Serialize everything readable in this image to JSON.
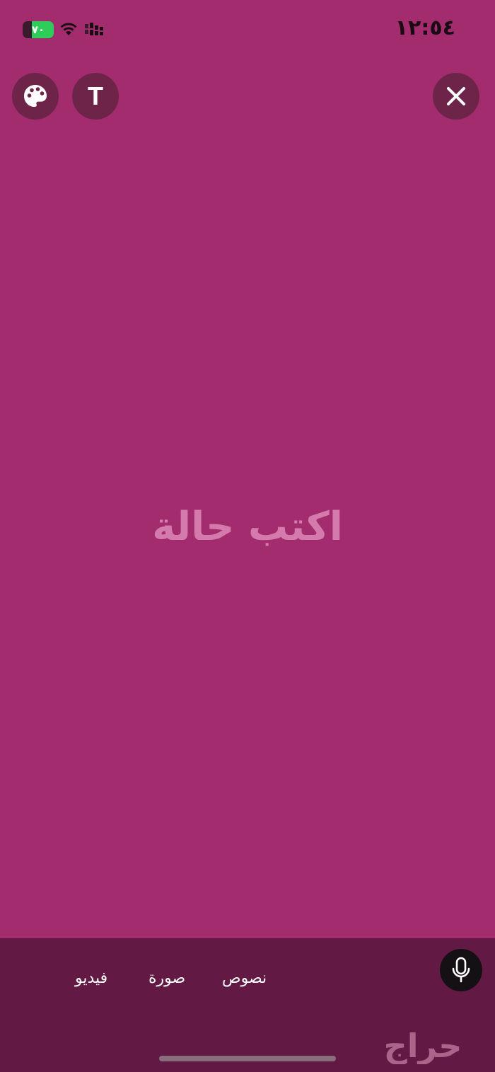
{
  "status_bar": {
    "time": "١٢:٥٤",
    "battery_label": "٧٠",
    "battery_level": 0.7,
    "battery_color": "#2ECC5A",
    "wifi_icon": "wifi-icon",
    "signal_icon": "signal-icon"
  },
  "toolbar": {
    "palette_icon": "palette-icon",
    "text_label": "T",
    "close_icon": "close-icon"
  },
  "editor": {
    "placeholder": "اكتب حالة",
    "background_color": "#A22C6E"
  },
  "bottom_bar": {
    "tabs": [
      {
        "label": "نصوص"
      },
      {
        "label": "صورة"
      },
      {
        "label": "فيديو"
      }
    ],
    "mic_icon": "microphone-icon"
  },
  "watermark": {
    "text": "حراج"
  }
}
